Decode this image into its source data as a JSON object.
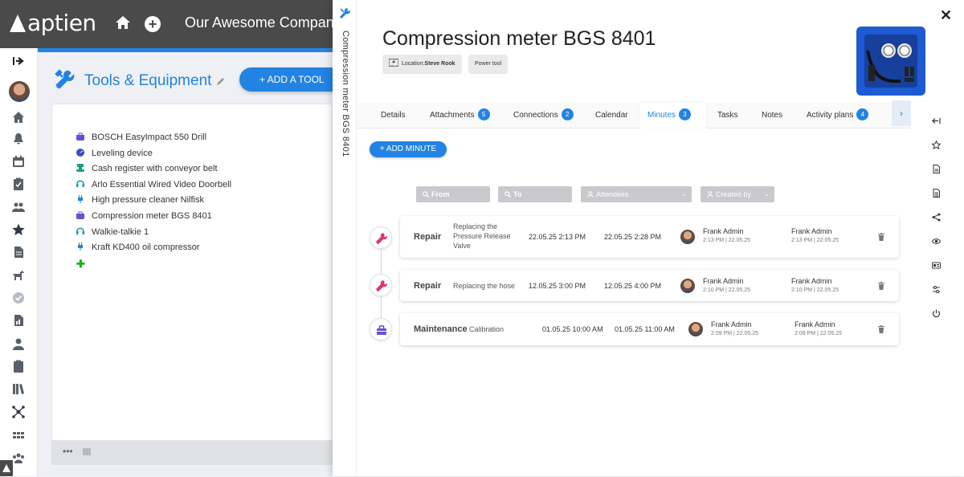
{
  "topbar": {
    "logo_text": "aptien",
    "company_name": "Our Awesome Company"
  },
  "colors": {
    "accent": "#2383e2",
    "topbar_bg": "#4a4a4a",
    "repair_icon": "#e0347a",
    "maintenance_icon": "#6a4fd0"
  },
  "leftnav": {
    "icons": [
      "collapse-arrow-icon",
      "user-avatar",
      "home-icon",
      "bell-icon",
      "calendar-icon",
      "clipboard-icon",
      "people-icon",
      "star-icon",
      "document-icon",
      "dog-icon",
      "check-icon",
      "report-icon",
      "person-icon",
      "clipboard-alt-icon",
      "books-icon",
      "network-icon",
      "grid-icon",
      "team-icon",
      "logo-small-icon"
    ]
  },
  "background": {
    "title": "Tools & Equipment",
    "add_button": "+ ADD A TOOL",
    "items": [
      {
        "label": "BOSCH EasyImpact 550 Drill",
        "icon": "toolbox-icon",
        "color": "#6a4fd0"
      },
      {
        "label": "Leveling device",
        "icon": "gauge-icon",
        "color": "#3a4fc8"
      },
      {
        "label": "Cash register with conveyor belt",
        "icon": "register-icon",
        "color": "#17a085"
      },
      {
        "label": "Arlo Essential Wired Video Doorbell",
        "icon": "headset-icon",
        "color": "#17a0a0"
      },
      {
        "label": "High pressure cleaner Nilfisk",
        "icon": "plug-icon",
        "color": "#2383e2"
      },
      {
        "label": "Compression meter BGS 8401",
        "icon": "toolbox-icon",
        "color": "#6a4fd0"
      },
      {
        "label": "Walkie-talkie 1",
        "icon": "headset-icon",
        "color": "#17a0a0"
      },
      {
        "label": "Kraft KD400 oil compressor",
        "icon": "plug-icon",
        "color": "#2383e2"
      }
    ],
    "footer_dots": "•••"
  },
  "panel": {
    "vertical_title": "Compression meter BGS 8401",
    "title": "Compression meter BGS 8401",
    "location_label": "Location:",
    "location_value": "Steve Rook",
    "category": "Power tool",
    "close": "✕",
    "tabs": [
      {
        "label": "Details",
        "count": null,
        "active": false
      },
      {
        "label": "Attachments",
        "count": "5",
        "active": false
      },
      {
        "label": "Connections",
        "count": "2",
        "active": false
      },
      {
        "label": "Calendar",
        "count": null,
        "active": false
      },
      {
        "label": "Minutes",
        "count": "3",
        "active": true
      },
      {
        "label": "Tasks",
        "count": null,
        "active": false
      },
      {
        "label": "Notes",
        "count": null,
        "active": false
      },
      {
        "label": "Activity plans",
        "count": "4",
        "active": false
      }
    ],
    "add_minute": "+ ADD MINUTE",
    "filters": {
      "from": "From",
      "to": "To",
      "attendees": "Attendees",
      "created_by": "Created by"
    },
    "minutes": [
      {
        "type": "Repair",
        "icon": "wrench-icon",
        "description": [
          "Replacing the",
          "Pressure Release",
          "Valve"
        ],
        "start": "22.05.25 2:13 PM",
        "end": "22.05.25 2:28 PM",
        "attendee_name": "Frank Admin",
        "attendee_meta": "2:13 PM | 22.05.25",
        "creator_name": "Frank Admin",
        "creator_meta": "2:13 PM | 22.05.25"
      },
      {
        "type": "Repair",
        "icon": "wrench-icon",
        "description": [
          "Replacing the hose"
        ],
        "start": "12.05.25 3:00 PM",
        "end": "12.05.25 4:00 PM",
        "attendee_name": "Frank Admin",
        "attendee_meta": "2:10 PM | 22.05.25",
        "creator_name": "Frank Admin",
        "creator_meta": "2:10 PM | 22.05.25"
      },
      {
        "type": "Maintenance",
        "icon": "toolbox-icon",
        "description": [
          "Calibration"
        ],
        "start": "01.05.25 10:00 AM",
        "end": "01.05.25 11:00 AM",
        "attendee_name": "Frank Admin",
        "attendee_meta": "2:09 PM | 22.05.25",
        "creator_name": "Frank Admin",
        "creator_meta": "2:09 PM | 22.05.25"
      }
    ],
    "right_toolbar": [
      "collapse-left-icon",
      "star-icon",
      "document-icon",
      "document-alt-icon",
      "share-icon",
      "eye-icon",
      "id-card-icon",
      "settings-sliders-icon",
      "power-icon"
    ]
  }
}
